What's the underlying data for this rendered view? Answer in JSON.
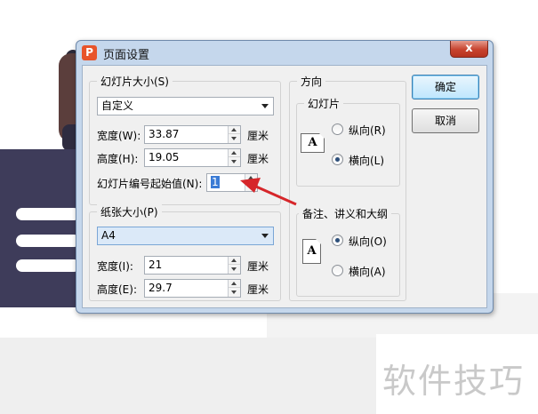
{
  "dialog": {
    "title": "页面设置",
    "app_icon_glyph": "P",
    "close_glyph": "x"
  },
  "slide_size": {
    "legend": "幻灯片大小(S)",
    "preset": "自定义",
    "width_label": "宽度(W):",
    "width_value": "33.87",
    "height_label": "高度(H):",
    "height_value": "19.05",
    "unit": "厘米",
    "start_num_label": "幻灯片编号起始值(N):",
    "start_num_value": "1"
  },
  "paper_size": {
    "legend": "纸张大小(P)",
    "preset": "A4",
    "width_label": "宽度(I):",
    "width_value": "21",
    "height_label": "高度(E):",
    "height_value": "29.7",
    "unit": "厘米"
  },
  "orientation": {
    "legend": "方向",
    "slides": {
      "legend": "幻灯片",
      "portrait": "纵向(R)",
      "landscape": "横向(L)",
      "selected": "landscape"
    },
    "notes": {
      "legend": "备注、讲义和大纲",
      "portrait": "纵向(O)",
      "landscape": "横向(A)",
      "selected": "portrait"
    },
    "page_glyph": "A"
  },
  "buttons": {
    "ok": "确定",
    "cancel": "取消"
  },
  "watermark": "软件技巧",
  "colors": {
    "annotation_arrow": "#d6262a",
    "dialog_frame": "#c5d7ec",
    "accent": "#3a7bd5"
  }
}
